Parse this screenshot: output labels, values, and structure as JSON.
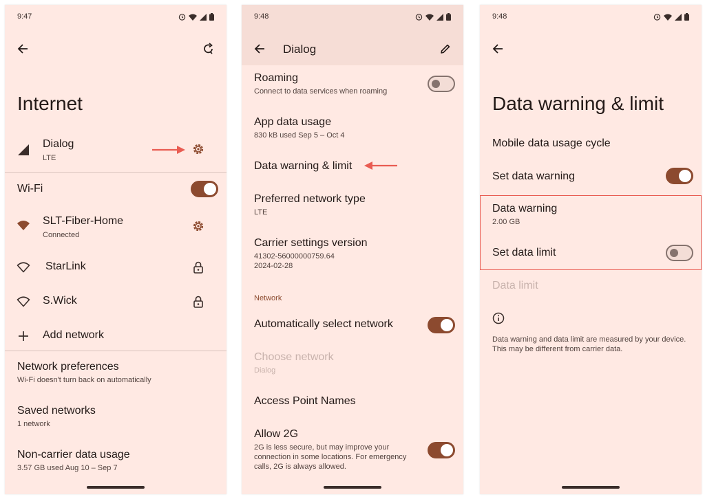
{
  "colors": {
    "accent": "#8c4a2f",
    "screen_bg": "#ffe9e3",
    "annotation": "#e95c52"
  },
  "screen1": {
    "time": "9:47",
    "title": "Internet",
    "dialog": {
      "label": "Dialog",
      "sub": "LTE"
    },
    "wifi": {
      "label": "Wi-Fi",
      "enabled": true
    },
    "networks": [
      {
        "name": "SLT-Fiber-Home",
        "sub": "Connected",
        "icon": "wifi-filled-icon",
        "trail": "gear-icon"
      },
      {
        "name": "StarLink",
        "sub": "",
        "icon": "wifi-outline-icon",
        "trail": "lock-icon"
      },
      {
        "name": "S.Wick",
        "sub": "",
        "icon": "wifi-outline-icon",
        "trail": "lock-icon"
      }
    ],
    "add_network": "Add network",
    "network_preferences": {
      "label": "Network preferences",
      "sub": "Wi-Fi doesn't turn back on automatically"
    },
    "saved_networks": {
      "label": "Saved networks",
      "sub": "1 network"
    },
    "non_carrier": {
      "label": "Non-carrier data usage",
      "sub": "3.57 GB used Aug 10 – Sep 7"
    }
  },
  "screen2": {
    "time": "9:48",
    "title": "Dialog",
    "roaming": {
      "label": "Roaming",
      "sub": "Connect to data services when roaming",
      "enabled": false
    },
    "app_data_usage": {
      "label": "App data usage",
      "sub": "830 kB used Sep 5 – Oct 4"
    },
    "data_warning_limit": "Data warning & limit",
    "preferred_network": {
      "label": "Preferred network type",
      "sub": "LTE"
    },
    "carrier_settings": {
      "label": "Carrier settings version",
      "sub1": "41302-56000000759.64",
      "sub2": "2024-02-28"
    },
    "section_network": "Network",
    "auto_select": {
      "label": "Automatically select network",
      "enabled": true
    },
    "choose_network": {
      "label": "Choose network",
      "sub": "Dialog"
    },
    "apn": "Access Point Names",
    "allow2g": {
      "label": "Allow 2G",
      "sub1": "2G is less secure, but may improve your",
      "sub2": "connection in some locations. For emergency",
      "sub3": "calls, 2G is always allowed.",
      "enabled": true
    }
  },
  "screen3": {
    "time": "9:48",
    "title": "Data warning & limit",
    "cycle": "Mobile data usage cycle",
    "set_warning": {
      "label": "Set data warning",
      "enabled": true
    },
    "data_warning": {
      "label": "Data warning",
      "sub": "2.00 GB"
    },
    "set_limit": {
      "label": "Set data limit",
      "enabled": false
    },
    "data_limit": "Data limit",
    "info1": "Data warning and data limit are measured by your device.",
    "info2": "This may be different from carrier data."
  }
}
